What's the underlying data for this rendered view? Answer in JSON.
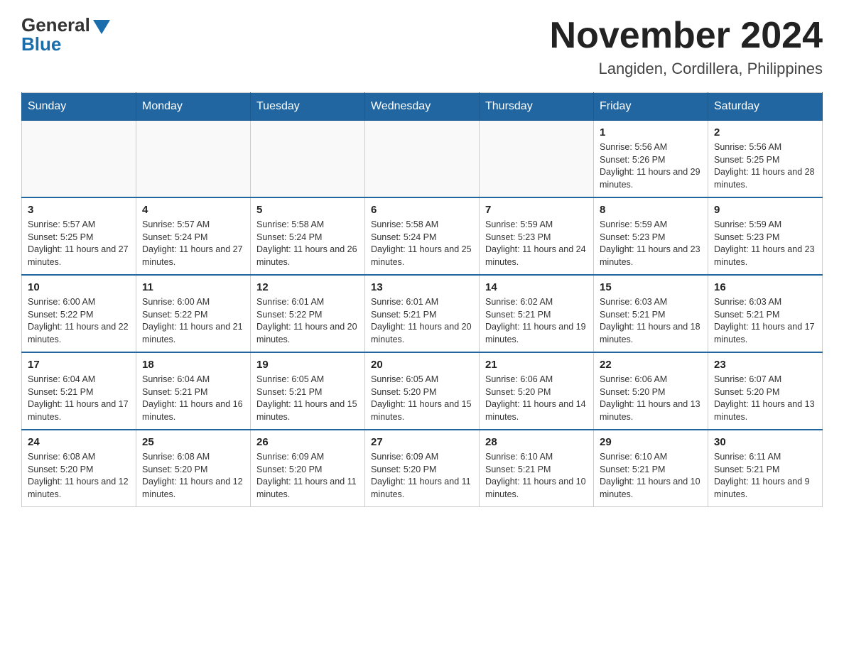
{
  "logo": {
    "general": "General",
    "blue": "Blue"
  },
  "title": "November 2024",
  "location": "Langiden, Cordillera, Philippines",
  "days_header": [
    "Sunday",
    "Monday",
    "Tuesday",
    "Wednesday",
    "Thursday",
    "Friday",
    "Saturday"
  ],
  "weeks": [
    [
      {
        "day": "",
        "info": ""
      },
      {
        "day": "",
        "info": ""
      },
      {
        "day": "",
        "info": ""
      },
      {
        "day": "",
        "info": ""
      },
      {
        "day": "",
        "info": ""
      },
      {
        "day": "1",
        "info": "Sunrise: 5:56 AM\nSunset: 5:26 PM\nDaylight: 11 hours and 29 minutes."
      },
      {
        "day": "2",
        "info": "Sunrise: 5:56 AM\nSunset: 5:25 PM\nDaylight: 11 hours and 28 minutes."
      }
    ],
    [
      {
        "day": "3",
        "info": "Sunrise: 5:57 AM\nSunset: 5:25 PM\nDaylight: 11 hours and 27 minutes."
      },
      {
        "day": "4",
        "info": "Sunrise: 5:57 AM\nSunset: 5:24 PM\nDaylight: 11 hours and 27 minutes."
      },
      {
        "day": "5",
        "info": "Sunrise: 5:58 AM\nSunset: 5:24 PM\nDaylight: 11 hours and 26 minutes."
      },
      {
        "day": "6",
        "info": "Sunrise: 5:58 AM\nSunset: 5:24 PM\nDaylight: 11 hours and 25 minutes."
      },
      {
        "day": "7",
        "info": "Sunrise: 5:59 AM\nSunset: 5:23 PM\nDaylight: 11 hours and 24 minutes."
      },
      {
        "day": "8",
        "info": "Sunrise: 5:59 AM\nSunset: 5:23 PM\nDaylight: 11 hours and 23 minutes."
      },
      {
        "day": "9",
        "info": "Sunrise: 5:59 AM\nSunset: 5:23 PM\nDaylight: 11 hours and 23 minutes."
      }
    ],
    [
      {
        "day": "10",
        "info": "Sunrise: 6:00 AM\nSunset: 5:22 PM\nDaylight: 11 hours and 22 minutes."
      },
      {
        "day": "11",
        "info": "Sunrise: 6:00 AM\nSunset: 5:22 PM\nDaylight: 11 hours and 21 minutes."
      },
      {
        "day": "12",
        "info": "Sunrise: 6:01 AM\nSunset: 5:22 PM\nDaylight: 11 hours and 20 minutes."
      },
      {
        "day": "13",
        "info": "Sunrise: 6:01 AM\nSunset: 5:21 PM\nDaylight: 11 hours and 20 minutes."
      },
      {
        "day": "14",
        "info": "Sunrise: 6:02 AM\nSunset: 5:21 PM\nDaylight: 11 hours and 19 minutes."
      },
      {
        "day": "15",
        "info": "Sunrise: 6:03 AM\nSunset: 5:21 PM\nDaylight: 11 hours and 18 minutes."
      },
      {
        "day": "16",
        "info": "Sunrise: 6:03 AM\nSunset: 5:21 PM\nDaylight: 11 hours and 17 minutes."
      }
    ],
    [
      {
        "day": "17",
        "info": "Sunrise: 6:04 AM\nSunset: 5:21 PM\nDaylight: 11 hours and 17 minutes."
      },
      {
        "day": "18",
        "info": "Sunrise: 6:04 AM\nSunset: 5:21 PM\nDaylight: 11 hours and 16 minutes."
      },
      {
        "day": "19",
        "info": "Sunrise: 6:05 AM\nSunset: 5:21 PM\nDaylight: 11 hours and 15 minutes."
      },
      {
        "day": "20",
        "info": "Sunrise: 6:05 AM\nSunset: 5:20 PM\nDaylight: 11 hours and 15 minutes."
      },
      {
        "day": "21",
        "info": "Sunrise: 6:06 AM\nSunset: 5:20 PM\nDaylight: 11 hours and 14 minutes."
      },
      {
        "day": "22",
        "info": "Sunrise: 6:06 AM\nSunset: 5:20 PM\nDaylight: 11 hours and 13 minutes."
      },
      {
        "day": "23",
        "info": "Sunrise: 6:07 AM\nSunset: 5:20 PM\nDaylight: 11 hours and 13 minutes."
      }
    ],
    [
      {
        "day": "24",
        "info": "Sunrise: 6:08 AM\nSunset: 5:20 PM\nDaylight: 11 hours and 12 minutes."
      },
      {
        "day": "25",
        "info": "Sunrise: 6:08 AM\nSunset: 5:20 PM\nDaylight: 11 hours and 12 minutes."
      },
      {
        "day": "26",
        "info": "Sunrise: 6:09 AM\nSunset: 5:20 PM\nDaylight: 11 hours and 11 minutes."
      },
      {
        "day": "27",
        "info": "Sunrise: 6:09 AM\nSunset: 5:20 PM\nDaylight: 11 hours and 11 minutes."
      },
      {
        "day": "28",
        "info": "Sunrise: 6:10 AM\nSunset: 5:21 PM\nDaylight: 11 hours and 10 minutes."
      },
      {
        "day": "29",
        "info": "Sunrise: 6:10 AM\nSunset: 5:21 PM\nDaylight: 11 hours and 10 minutes."
      },
      {
        "day": "30",
        "info": "Sunrise: 6:11 AM\nSunset: 5:21 PM\nDaylight: 11 hours and 9 minutes."
      }
    ]
  ]
}
